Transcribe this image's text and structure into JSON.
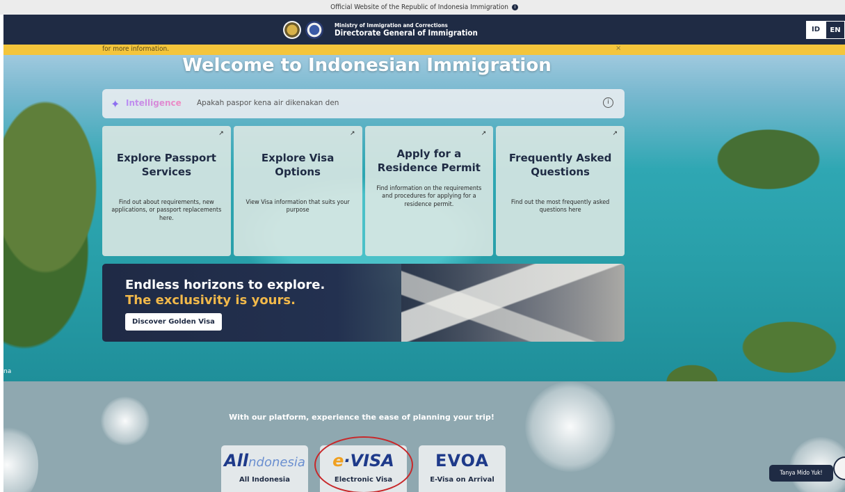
{
  "top_strip": {
    "text": "Official Website of the Republic of Indonesia Immigration",
    "info_glyph": "i"
  },
  "header": {
    "ministry": "Ministry of Immigration and Corrections",
    "directorate": "Directorate General of Immigration",
    "lang_id": "ID",
    "lang_en": "EN"
  },
  "banner": {
    "text": "for more information.",
    "close": "×"
  },
  "hero": {
    "title": "Welcome to Indonesian Immigration"
  },
  "search": {
    "brand": "Intelligence",
    "spark": "✦",
    "value": "Apakah paspor kena air dikenakan den",
    "info": "i"
  },
  "cards": [
    {
      "arrow": "↗",
      "title": "Explore Passport Services",
      "desc": "Find out about requirements, new applications, or passport replacements here."
    },
    {
      "arrow": "↗",
      "title": "Explore Visa Options",
      "desc": "View Visa information that suits your purpose"
    },
    {
      "arrow": "↗",
      "title": "Apply for a Residence Permit",
      "desc": "Find information on the requirements and procedures for applying for a residence permit."
    },
    {
      "arrow": "↗",
      "title": "Frequently Asked Questions",
      "desc": "Find out the most frequently asked questions here"
    }
  ],
  "golden": {
    "line1": "Endless horizons to explore.",
    "line2": "The exclusivity is yours.",
    "button": "Discover Golden Visa"
  },
  "lower_left": "na",
  "platform": {
    "title": "With our platform, experience the ease of planning your trip!",
    "tiles": [
      {
        "logo_main": "All",
        "logo_sub": "ndonesia",
        "label": "All Indonesia"
      },
      {
        "logo_e": "e",
        "logo_rest": "·VISA",
        "label": "Electronic Visa"
      },
      {
        "logo_main": "EVOA",
        "label": "E-Visa on Arrival"
      }
    ]
  },
  "chat": {
    "label": "Tanya Mido Yuk!"
  },
  "colors": {
    "navy": "#1f2b44",
    "banner_yellow": "#f4c53b",
    "gold_text": "#f2b94a",
    "highlight_red": "#c8282a"
  }
}
